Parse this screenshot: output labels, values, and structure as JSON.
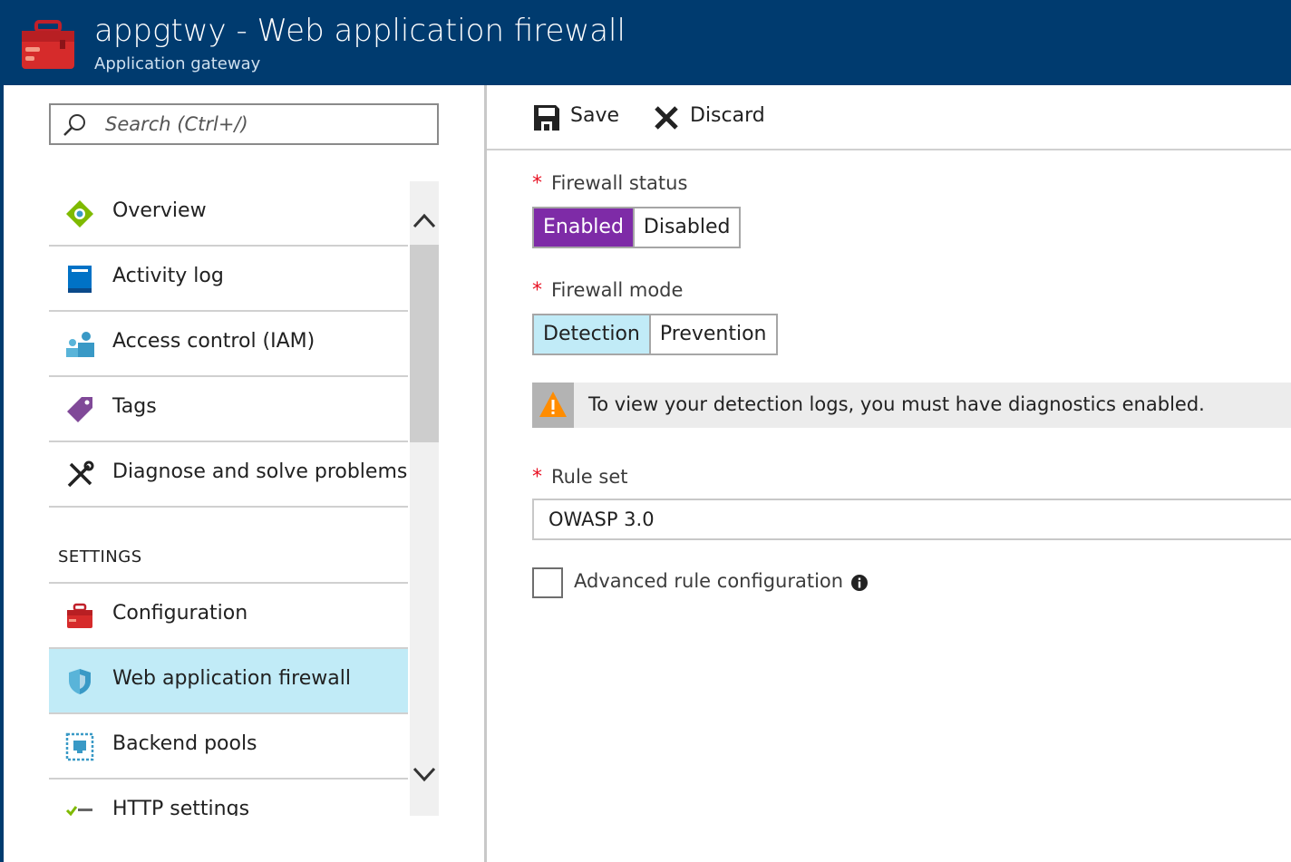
{
  "header": {
    "title": "appgtwy - Web application firewall",
    "subtitle": "Application gateway",
    "logo_icon": "toolbox-icon",
    "background_color": "#003b6f"
  },
  "search": {
    "placeholder": "Search (Ctrl+/)",
    "value": ""
  },
  "nav": {
    "items": [
      {
        "label": "Overview",
        "icon": "overview-icon"
      },
      {
        "label": "Activity log",
        "icon": "activity-log-icon"
      },
      {
        "label": "Access control (IAM)",
        "icon": "access-control-icon"
      },
      {
        "label": "Tags",
        "icon": "tag-icon"
      },
      {
        "label": "Diagnose and solve problems",
        "icon": "wrench-screwdriver-icon"
      }
    ],
    "section_header": "SETTINGS",
    "settings_items": [
      {
        "label": "Configuration",
        "icon": "toolbox-icon"
      },
      {
        "label": "Web application firewall",
        "icon": "shield-icon",
        "active": true
      },
      {
        "label": "Backend pools",
        "icon": "backend-pools-icon"
      },
      {
        "label": "HTTP settings",
        "icon": "http-settings-icon"
      }
    ]
  },
  "toolbar": {
    "save_label": "Save",
    "discard_label": "Discard"
  },
  "form": {
    "required_marker": "*",
    "firewall_status": {
      "label": "Firewall status",
      "options": [
        "Enabled",
        "Disabled"
      ],
      "selected": "Enabled",
      "selected_color": "#7e2ba7"
    },
    "firewall_mode": {
      "label": "Firewall mode",
      "options": [
        "Detection",
        "Prevention"
      ],
      "selected": "Detection",
      "selected_color": "#c1ebf7"
    },
    "warning": {
      "text": "To view your detection logs, you must have diagnostics enabled.",
      "icon": "warning-icon",
      "icon_color": "#ff8c00"
    },
    "rule_set": {
      "label": "Rule set",
      "value": "OWASP 3.0"
    },
    "advanced": {
      "label": "Advanced rule configuration",
      "checked": false,
      "info_icon": "info-icon"
    }
  }
}
